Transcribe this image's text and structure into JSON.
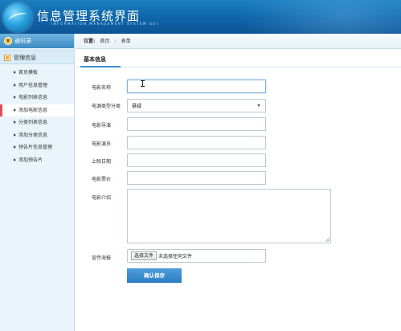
{
  "header": {
    "title": "信息管理系统界面",
    "subtitle": "INFORMATION MANAGEMENT SYSTEM GUI"
  },
  "sidebar": {
    "top_label": "通讯录",
    "group_label": "管理信息",
    "items": [
      {
        "label": "首页模板",
        "active": false
      },
      {
        "label": "用户信息管理",
        "active": false
      },
      {
        "label": "电影列表信息",
        "active": false
      },
      {
        "label": "添加电影信息",
        "active": true
      },
      {
        "label": "分类列表信息",
        "active": false
      },
      {
        "label": "添加分类信息",
        "active": false
      },
      {
        "label": "预告片信息管理",
        "active": false
      },
      {
        "label": "添加预告片",
        "active": false
      }
    ]
  },
  "breadcrumb": {
    "prefix": "位置:",
    "items": [
      "首页",
      "表单"
    ]
  },
  "form": {
    "section_title": "基本信息",
    "labels": {
      "name": "电影名称",
      "category": "电源类型分类",
      "director": "电影导演",
      "actors": "电影演员",
      "release": "上映日期",
      "price": "电影票价",
      "intro": "电影介绍",
      "poster": "宣传海报"
    },
    "values": {
      "name": "",
      "category": "悬疑",
      "director": "",
      "actors": "",
      "release": "",
      "price": "",
      "intro": ""
    },
    "file": {
      "button": "选择文件",
      "status": "未选择任何文件"
    },
    "save_label": "确认保存"
  }
}
